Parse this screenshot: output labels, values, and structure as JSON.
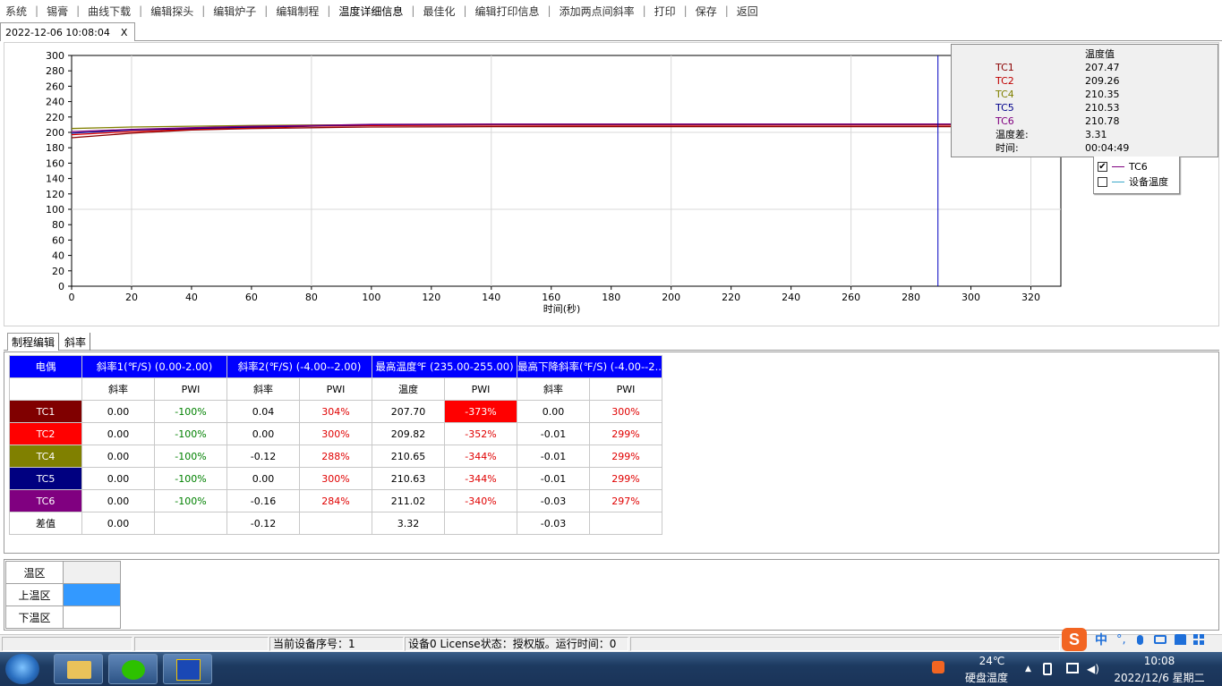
{
  "menu": [
    "系统",
    "锡膏",
    "曲线下载",
    "编辑探头",
    "编辑炉子",
    "编辑制程",
    "温度详细信息",
    "最佳化",
    "编辑打印信息",
    "添加两点间斜率",
    "打印",
    "保存",
    "返回"
  ],
  "doc_tab": {
    "label": "2022-12-06 10:08:04",
    "close": "X"
  },
  "chart_data": {
    "type": "line",
    "xlabel": "时间(秒)",
    "ylabel": "",
    "xlim": [
      0,
      330
    ],
    "ylim": [
      0,
      300
    ],
    "xticks": [
      0,
      20,
      40,
      60,
      80,
      100,
      120,
      140,
      160,
      180,
      200,
      220,
      240,
      260,
      280,
      300,
      320
    ],
    "yticks": [
      0,
      20,
      40,
      60,
      80,
      100,
      120,
      140,
      160,
      180,
      200,
      220,
      240,
      260,
      280,
      300
    ],
    "grid": true,
    "cursor_x": 289,
    "series": [
      {
        "name": "TC1",
        "color": "#8b0000",
        "x": [
          0,
          20,
          40,
          60,
          80,
          100,
          140,
          200,
          260,
          289
        ],
        "y": [
          193,
          199,
          203,
          205,
          206,
          207,
          207.5,
          207.5,
          207.5,
          207.47
        ]
      },
      {
        "name": "TC2",
        "color": "#e00000",
        "x": [
          0,
          20,
          40,
          60,
          80,
          100,
          140,
          200,
          260,
          289
        ],
        "y": [
          197,
          201,
          204,
          206,
          208,
          209,
          209.3,
          209.2,
          209.3,
          209.26
        ]
      },
      {
        "name": "TC4",
        "color": "#808000",
        "x": [
          0,
          20,
          40,
          60,
          80,
          100,
          140,
          200,
          260,
          289
        ],
        "y": [
          205,
          207,
          208,
          209,
          209.5,
          210,
          210.3,
          210.3,
          210.3,
          210.35
        ]
      },
      {
        "name": "TC5",
        "color": "#00008b",
        "x": [
          0,
          20,
          40,
          60,
          80,
          100,
          140,
          200,
          260,
          289
        ],
        "y": [
          199,
          203,
          205,
          207,
          208.5,
          210,
          210.5,
          210.5,
          210.5,
          210.53
        ]
      },
      {
        "name": "TC6",
        "color": "#800080",
        "x": [
          0,
          20,
          40,
          60,
          80,
          100,
          140,
          200,
          260,
          289
        ],
        "y": [
          201,
          204,
          206,
          208,
          209,
          210.5,
          210.8,
          210.8,
          210.8,
          210.78
        ]
      }
    ]
  },
  "readout": {
    "header": "温度值",
    "rows": [
      {
        "label": "TC1",
        "value": "207.47",
        "color": "#8b0000"
      },
      {
        "label": "TC2",
        "value": "209.26",
        "color": "#c00000"
      },
      {
        "label": "TC4",
        "value": "210.35",
        "color": "#808000"
      },
      {
        "label": "TC5",
        "value": "210.53",
        "color": "#00008b"
      },
      {
        "label": "TC6",
        "value": "210.78",
        "color": "#800080"
      },
      {
        "label": "温度差:",
        "value": "3.31",
        "color": "#000000"
      },
      {
        "label": "时间:",
        "value": "00:04:49",
        "color": "#000000"
      }
    ]
  },
  "legend": [
    {
      "label": "TC6",
      "checked": true,
      "color": "#800080"
    },
    {
      "label": "设备温度",
      "checked": false,
      "color": "#3aa8c8"
    }
  ],
  "sub_tabs": [
    "制程编辑",
    "斜率"
  ],
  "table": {
    "headers": [
      "电偶",
      "斜率1(℉/S) (0.00-2.00)",
      "斜率2(℉/S) (-4.00--2.00)",
      "最高温度℉ (235.00-255.00)",
      "最高下降斜率(℉/S) (-4.00--2..."
    ],
    "subheaders": [
      "",
      "斜率",
      "PWI",
      "斜率",
      "PWI",
      "温度",
      "PWI",
      "斜率",
      "PWI"
    ],
    "rows": [
      {
        "name": "TC1",
        "color": "#800000",
        "cells": [
          "0.00",
          "-100%",
          "0.04",
          "304%",
          "207.70",
          "-373%",
          "0.00",
          "300%"
        ]
      },
      {
        "name": "TC2",
        "color": "#ff0000",
        "cells": [
          "0.00",
          "-100%",
          "0.00",
          "300%",
          "209.82",
          "-352%",
          "-0.01",
          "299%"
        ]
      },
      {
        "name": "TC4",
        "color": "#808000",
        "cells": [
          "0.00",
          "-100%",
          "-0.12",
          "288%",
          "210.65",
          "-344%",
          "-0.01",
          "299%"
        ]
      },
      {
        "name": "TC5",
        "color": "#000080",
        "cells": [
          "0.00",
          "-100%",
          "0.00",
          "300%",
          "210.63",
          "-344%",
          "-0.01",
          "299%"
        ]
      },
      {
        "name": "TC6",
        "color": "#800080",
        "cells": [
          "0.00",
          "-100%",
          "-0.16",
          "284%",
          "211.02",
          "-340%",
          "-0.03",
          "297%"
        ]
      },
      {
        "name": "差值",
        "color": "#ffffff",
        "cells": [
          "0.00",
          "",
          "-0.12",
          "",
          "3.32",
          "",
          "-0.03",
          ""
        ]
      }
    ]
  },
  "zones": [
    "温区",
    "上温区",
    "下温区"
  ],
  "status": {
    "device_no": "当前设备序号：1",
    "license": "设备0    License状态：授权版。运行时间：0"
  },
  "ime": {
    "lang": "中"
  },
  "tray": {
    "temp": "24℃",
    "temp_label": "硬盘温度",
    "time": "10:08",
    "date": "2022/12/6 星期二"
  }
}
